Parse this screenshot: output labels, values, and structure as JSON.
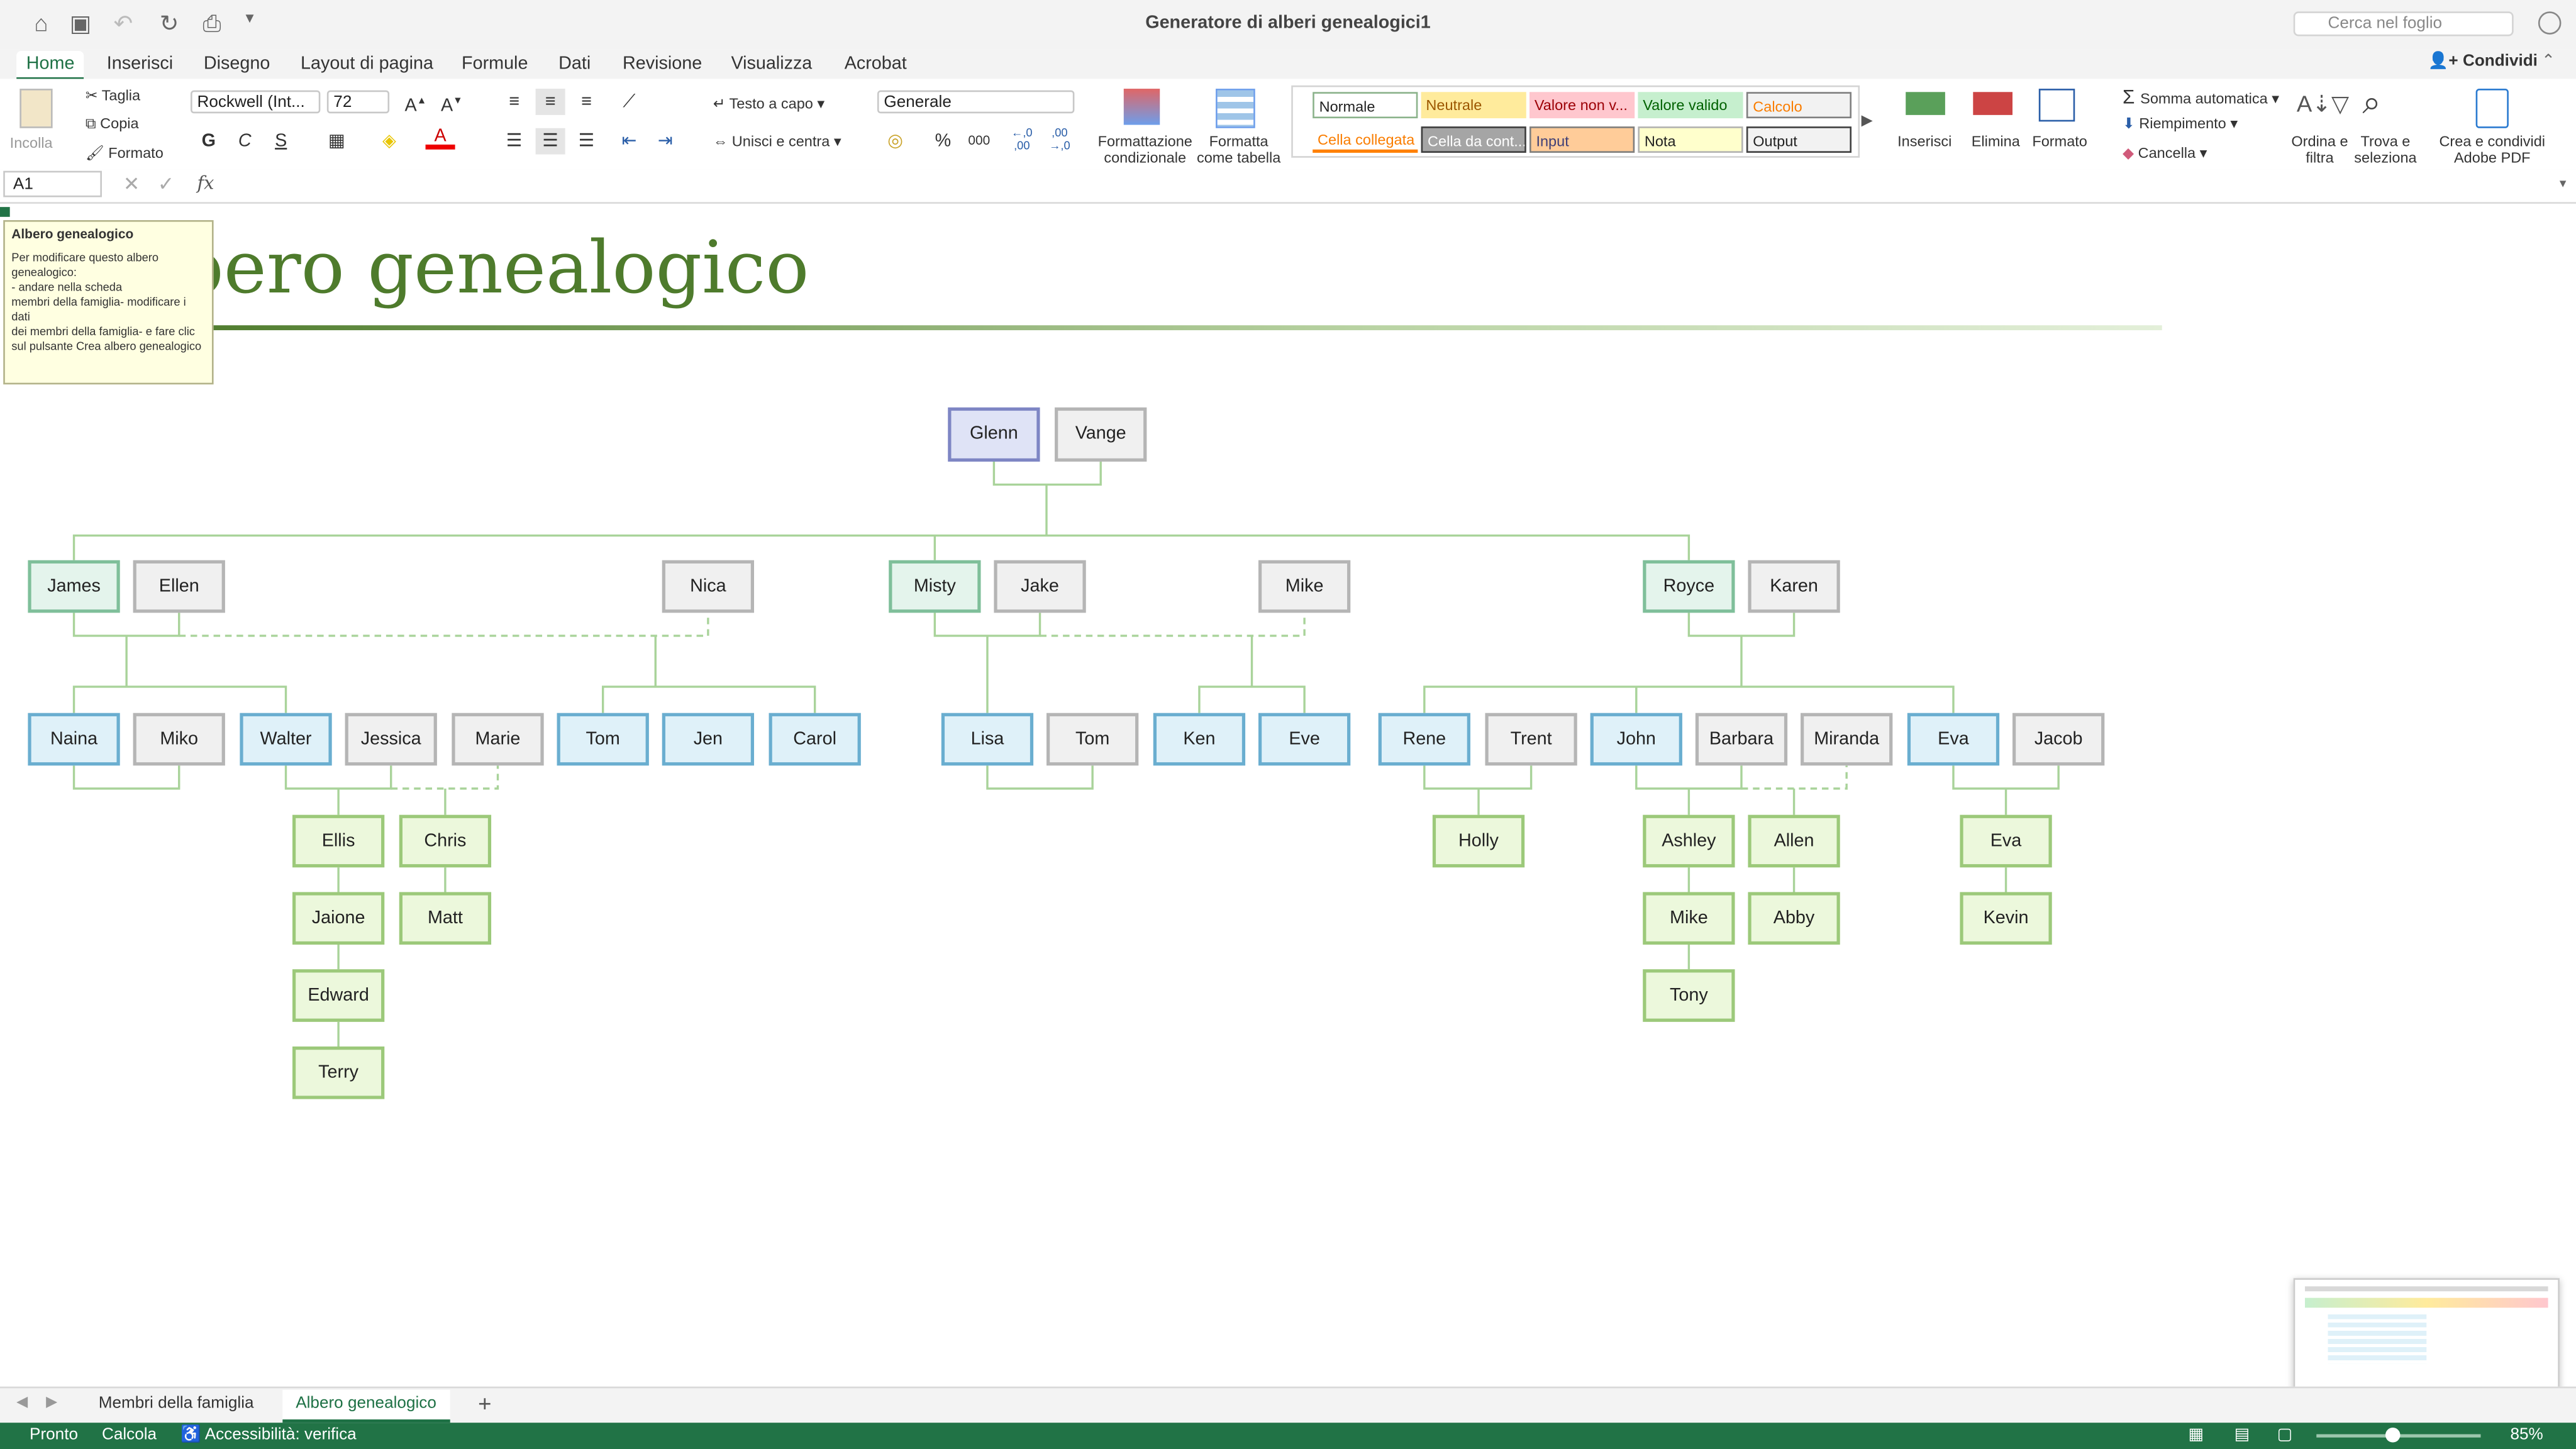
{
  "window": {
    "title": "Generatore di alberi genealogici1",
    "search_placeholder": "Cerca nel foglio"
  },
  "ribbon_tabs": [
    "Home",
    "Inserisci",
    "Disegno",
    "Layout di pagina",
    "Formule",
    "Dati",
    "Revisione",
    "Visualizza",
    "Acrobat"
  ],
  "share_label": "Condividi",
  "clipboard": {
    "paste": "Incolla",
    "cut": "Taglia",
    "copy": "Copia",
    "format": "Formato"
  },
  "font": {
    "name": "Rockwell (Int...",
    "size": "72",
    "bold": "G",
    "italic": "C",
    "underline": "S"
  },
  "alignment": {
    "wrap": "Testo a capo",
    "merge": "Unisci e centra"
  },
  "number": {
    "format": "Generale",
    "percent": "%",
    "thousands": "000",
    "inc_decimal": "←,0 ,00",
    "dec_decimal": ",00 →,0"
  },
  "buttons": {
    "conditional": "Formattazione condizionale",
    "table": "Formatta come tabella",
    "insert": "Inserisci",
    "delete": "Elimina",
    "format": "Formato",
    "autosum": "Somma automatica",
    "fill": "Riempimento",
    "clear": "Cancella",
    "sort": "Ordina e filtra",
    "find": "Trova e seleziona",
    "pdf": "Crea e condividi Adobe PDF"
  },
  "styles": [
    "Normale",
    "Neutrale",
    "Valore non v...",
    "Valore valido",
    "Calcolo",
    "Cella collegata",
    "Cella da cont...",
    "Input",
    "Nota",
    "Output"
  ],
  "formula": {
    "cell_ref": "A1",
    "fx": "fx"
  },
  "sheet": {
    "title": "bero genealogico"
  },
  "tooltip": {
    "heading": "Albero genealogico",
    "body": "Per modificare questo albero genealogico:\n- andare nella scheda\n membri della famiglia- modificare i dati\n dei membri della famiglia- e fare clic sul pulsante Crea albero genealogico"
  },
  "tree": {
    "gen1": [
      "Glenn",
      "Vange"
    ],
    "gen2": [
      "James",
      "Ellen",
      "Nica",
      "Misty",
      "Jake",
      "Mike",
      "Royce",
      "Karen"
    ],
    "gen3": [
      "Naina",
      "Miko",
      "Walter",
      "Jessica",
      "Marie",
      "Tom",
      "Jen",
      "Carol",
      "Lisa",
      "Tom",
      "Ken",
      "Eve",
      "Rene",
      "Trent",
      "John",
      "Barbara",
      "Miranda",
      "Eva",
      "Jacob"
    ],
    "gen4": [
      "Ellis",
      "Chris",
      "Jaione",
      "Matt",
      "Edward",
      "Terry",
      "Holly",
      "Ashley",
      "Allen",
      "Mike",
      "Abby",
      "Tony",
      "Eva",
      "Kevin"
    ]
  },
  "sheet_tabs": [
    "Membri della famiglia",
    "Albero genealogico"
  ],
  "statusbar": {
    "ready": "Pronto",
    "calc": "Calcola",
    "accessibility": "Accessibilità: verifica",
    "zoom": "85%"
  }
}
